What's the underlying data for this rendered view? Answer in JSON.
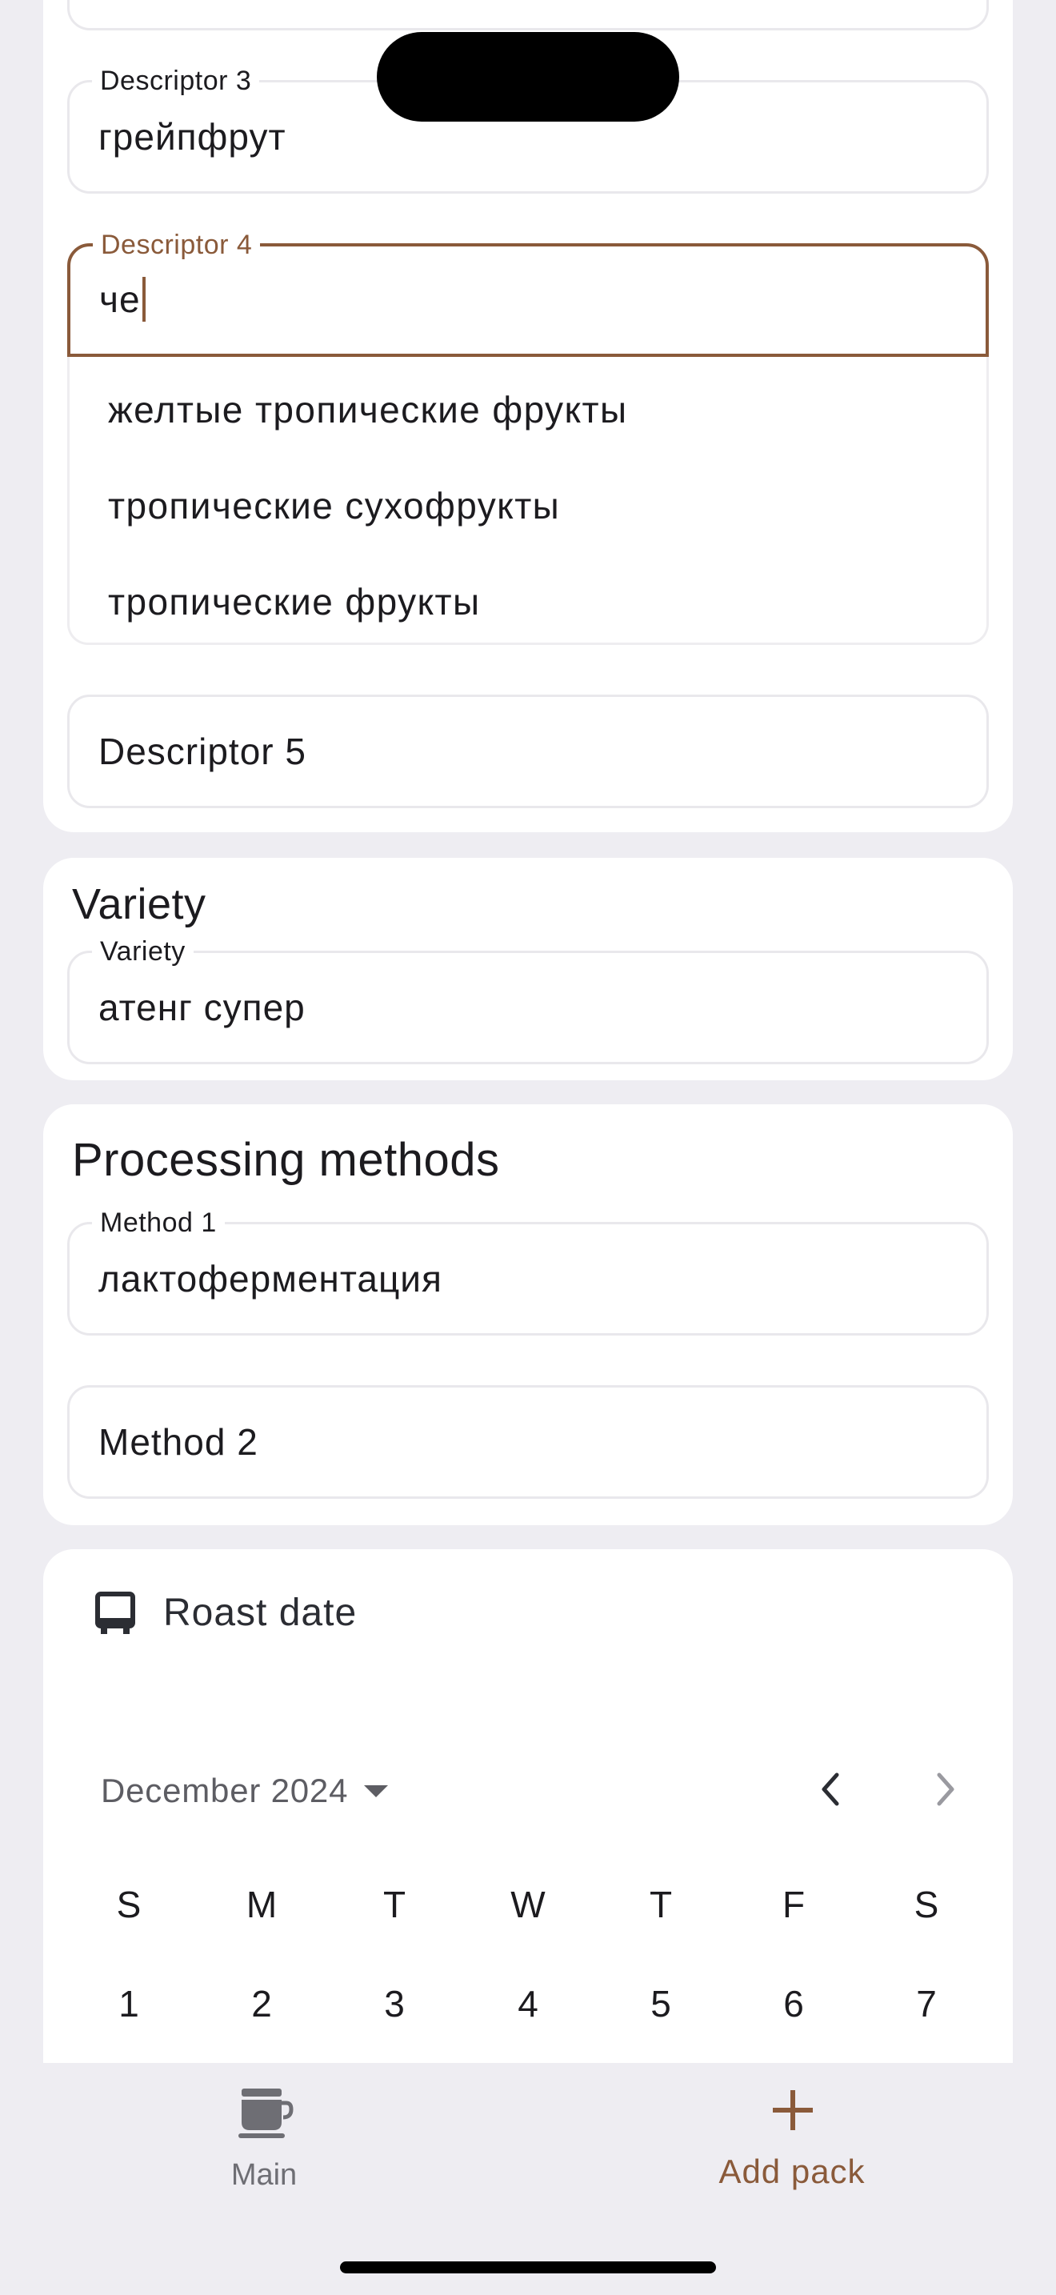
{
  "descriptors": {
    "descriptor3": {
      "label": "Descriptor 3",
      "value": "грейпфрут"
    },
    "descriptor4": {
      "label": "Descriptor 4",
      "value": "че"
    },
    "suggestions": [
      "желтые тропические фрукты",
      "тропические сухофрукты",
      "тропические фрукты"
    ],
    "descriptor5": {
      "placeholder": "Descriptor 5"
    }
  },
  "variety": {
    "title": "Variety",
    "field": {
      "label": "Variety",
      "value": "атенг супер"
    }
  },
  "processing": {
    "title": "Processing methods",
    "method1": {
      "label": "Method 1",
      "value": "лактоферментация"
    },
    "method2": {
      "placeholder": "Method 2"
    }
  },
  "roast_date": {
    "title": "Roast date",
    "icon": "calendar-icon",
    "month_label": "December 2024",
    "weekdays": [
      "S",
      "M",
      "T",
      "W",
      "T",
      "F",
      "S"
    ],
    "days": [
      "1",
      "2",
      "3",
      "4",
      "5",
      "6",
      "7"
    ]
  },
  "nav": {
    "main_label": "Main",
    "add_label": "Add pack",
    "main_icon": "coffee-cup-icon",
    "add_icon": "plus-icon"
  },
  "colors": {
    "accent": "#8a5a3a",
    "background": "#eeedf2",
    "card": "#ffffff"
  }
}
